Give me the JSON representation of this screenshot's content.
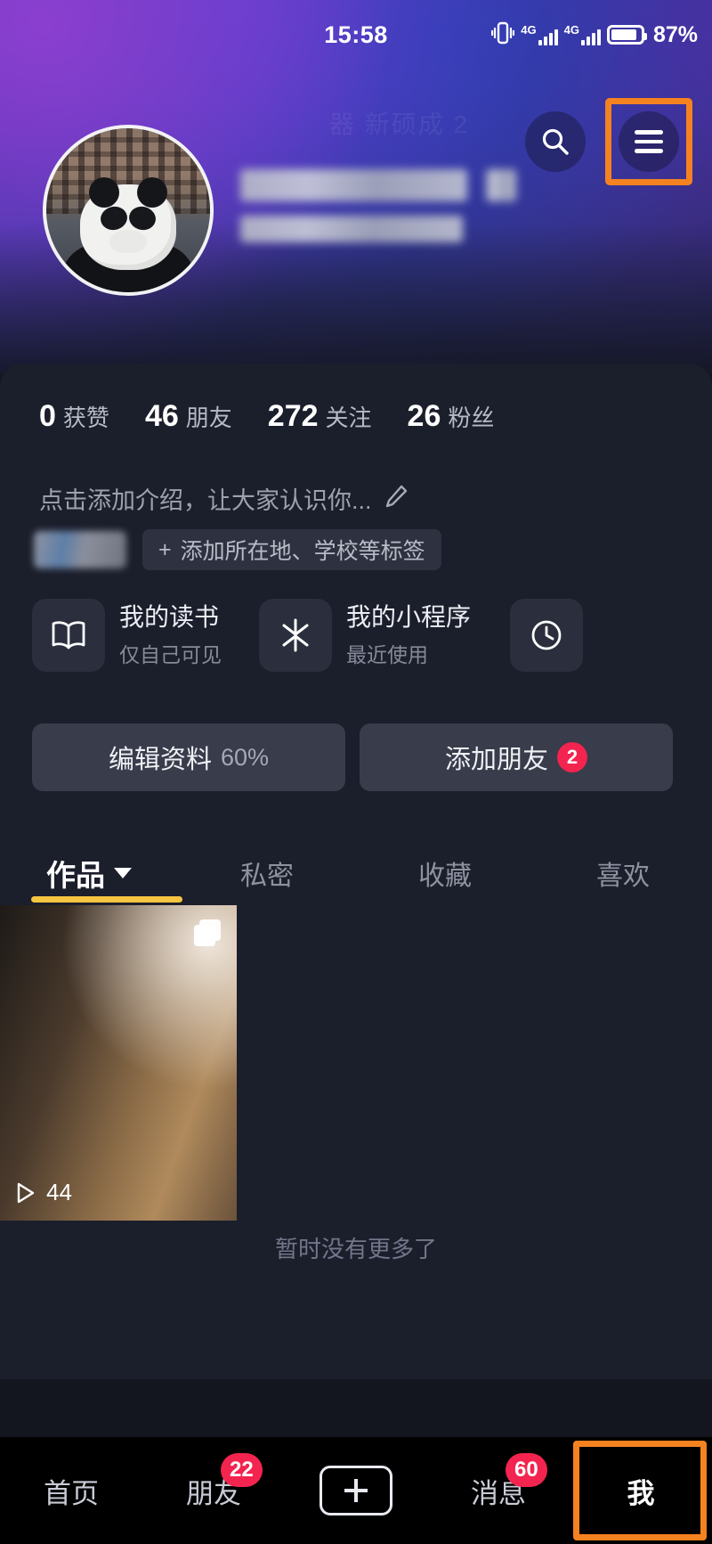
{
  "status_bar": {
    "time": "15:58",
    "battery_percent": "87%",
    "network_labels": [
      "4G",
      "4G"
    ],
    "icons": [
      "vibrate-icon",
      "signal-bars-icon",
      "battery-icon"
    ]
  },
  "header": {
    "search_icon": "search-icon",
    "menu_icon": "hamburger-menu-icon",
    "avatar": "user-avatar-panda",
    "name_redacted": true
  },
  "stats": [
    {
      "num": "0",
      "label": "获赞"
    },
    {
      "num": "46",
      "label": "朋友"
    },
    {
      "num": "272",
      "label": "关注"
    },
    {
      "num": "26",
      "label": "粉丝"
    }
  ],
  "bio": {
    "placeholder": "点击添加介绍，让大家认识你...",
    "edit_icon": "pencil-icon"
  },
  "tags": {
    "redacted_tag": true,
    "add_tag_label": "添加所在地、学校等标签",
    "add_tag_prefix": "+"
  },
  "shortcuts": [
    {
      "icon": "book-icon",
      "title": "我的读书",
      "subtitle": "仅自己可见"
    },
    {
      "icon": "mini-program-icon",
      "title": "我的小程序",
      "subtitle": "最近使用"
    },
    {
      "icon": "clock-history-icon",
      "title": "",
      "subtitle": ""
    }
  ],
  "actions": {
    "edit_profile_label": "编辑资料",
    "edit_profile_progress": "60%",
    "add_friend_label": "添加朋友",
    "add_friend_badge": "2"
  },
  "tabs": [
    {
      "label": "作品",
      "active": true,
      "has_caret": true
    },
    {
      "label": "私密",
      "active": false,
      "has_caret": false
    },
    {
      "label": "收藏",
      "active": false,
      "has_caret": false
    },
    {
      "label": "喜欢",
      "active": false,
      "has_caret": false
    }
  ],
  "videos": [
    {
      "play_count": "44",
      "multi_icon": "multi-image-icon",
      "play_icon": "play-icon"
    }
  ],
  "feed_footer": "暂时没有更多了",
  "bottom_nav": [
    {
      "label": "首页",
      "badge": "",
      "active": false
    },
    {
      "label": "朋友",
      "badge": "22",
      "active": false
    },
    {
      "label": "",
      "badge": "",
      "active": false,
      "icon": "plus-icon"
    },
    {
      "label": "消息",
      "badge": "60",
      "active": false
    },
    {
      "label": "我",
      "badge": "",
      "active": true
    }
  ],
  "colors": {
    "accent_orange": "#f58220",
    "badge_red": "#f3244f",
    "tab_underline": "#f5c542",
    "sheet_bg": "#1b1e2b",
    "nav_bg": "#000000"
  },
  "ghost_watermark": "器 新硕成 2"
}
